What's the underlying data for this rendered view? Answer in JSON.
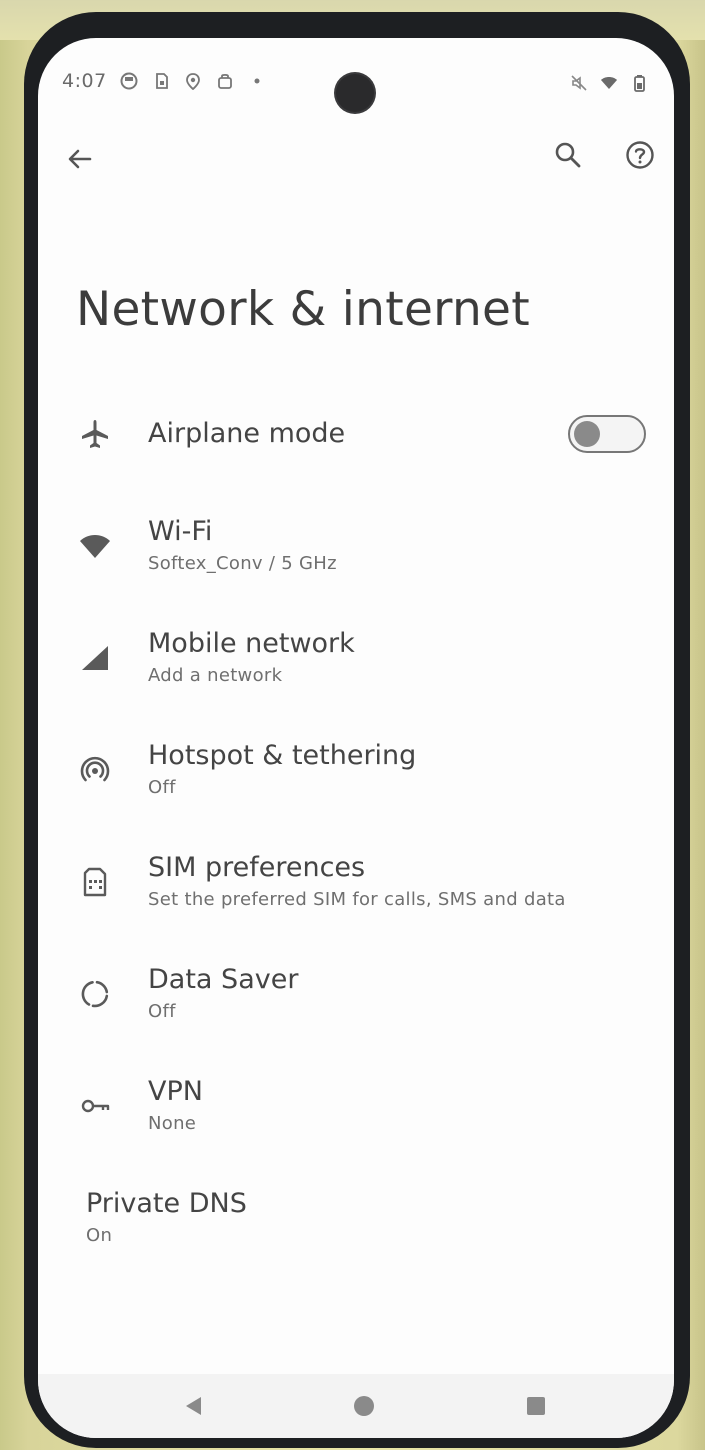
{
  "status_bar": {
    "time": "4:07",
    "left_icons": [
      "notification-icon",
      "sim-notification-icon",
      "location-icon",
      "bag-icon",
      "dot-icon"
    ],
    "right_icons": [
      "mute-icon",
      "wifi-signal-icon",
      "battery-icon"
    ]
  },
  "top_bar": {
    "back_icon": "arrow-back-icon",
    "search_icon": "search-icon",
    "help_icon": "help-icon"
  },
  "page": {
    "title": "Network & internet"
  },
  "settings": [
    {
      "id": "airplane-mode",
      "icon": "airplane-icon",
      "title": "Airplane mode",
      "summary": "",
      "toggle": false
    },
    {
      "id": "wifi",
      "icon": "wifi-icon",
      "title": "Wi-Fi",
      "summary": "Softex_Conv / 5 GHz"
    },
    {
      "id": "mobile-network",
      "icon": "signal-icon",
      "title": "Mobile network",
      "summary": "Add a network"
    },
    {
      "id": "hotspot",
      "icon": "hotspot-icon",
      "title": "Hotspot & tethering",
      "summary": "Off"
    },
    {
      "id": "sim-preferences",
      "icon": "sim-card-icon",
      "title": "SIM preferences",
      "summary": "Set the preferred SIM for calls, SMS and data"
    },
    {
      "id": "data-saver",
      "icon": "data-saver-icon",
      "title": "Data Saver",
      "summary": "Off"
    },
    {
      "id": "vpn",
      "icon": "key-icon",
      "title": "VPN",
      "summary": "None"
    },
    {
      "id": "private-dns",
      "icon": "",
      "title": "Private DNS",
      "summary": "On"
    }
  ],
  "nav_bar": {
    "back": "nav-back-icon",
    "home": "nav-home-icon",
    "recents": "nav-recents-icon"
  }
}
